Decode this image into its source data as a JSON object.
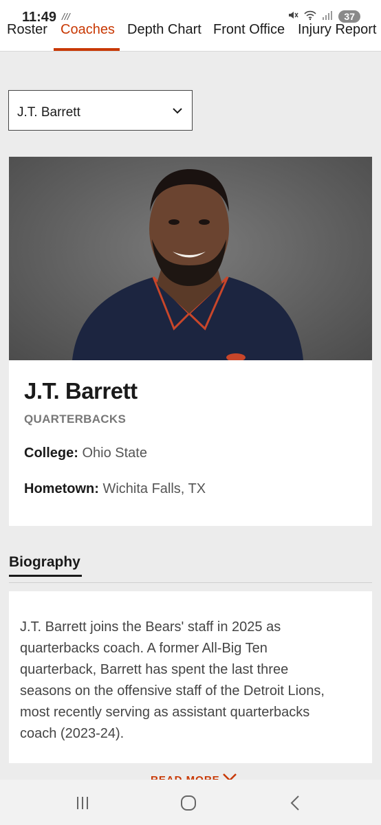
{
  "status_bar": {
    "time": "11:49",
    "battery": "37"
  },
  "nav": {
    "tabs": [
      {
        "label": "Roster",
        "active": false
      },
      {
        "label": "Coaches",
        "active": true
      },
      {
        "label": "Depth Chart",
        "active": false
      },
      {
        "label": "Front Office",
        "active": false
      },
      {
        "label": "Injury Report",
        "active": false
      }
    ]
  },
  "coach_select": {
    "value": "J.T. Barrett"
  },
  "coach": {
    "name": "J.T. Barrett",
    "position": "QUARTERBACKS",
    "college_label": "College:",
    "college": "Ohio State",
    "hometown_label": "Hometown:",
    "hometown": "Wichita Falls, TX"
  },
  "biography": {
    "heading": "Biography",
    "text": "J.T. Barrett joins the Bears' staff in 2025 as quarterbacks coach. A former All-Big Ten quarterback, Barrett has spent the last three seasons on the offensive staff of the Detroit Lions, most recently serving as assistant quarterbacks coach (2023-24).",
    "read_more": "READ MORE"
  },
  "colors": {
    "accent": "#c83803",
    "background": "#ececec"
  }
}
